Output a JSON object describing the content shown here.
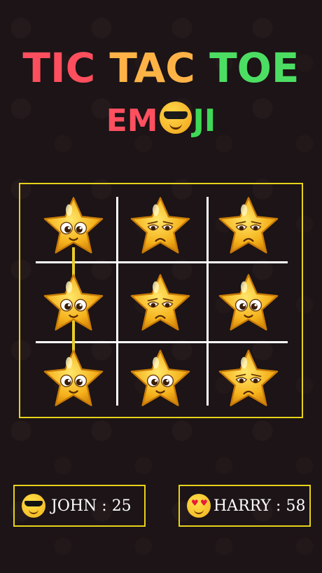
{
  "title": {
    "word1": "TIC",
    "word2": "TAC",
    "word3": "TOE",
    "sub_part1": "EM",
    "sub_part2": "JI",
    "sub_icon": "cool-sunglasses-emoji"
  },
  "colors": {
    "red": "#ff4f5e",
    "orange": "#ffb347",
    "green": "#4cde63",
    "border": "#e6d21c",
    "win_line": "#e8cc2a",
    "background": "#1c1416"
  },
  "board": {
    "cells": [
      {
        "row": 0,
        "col": 0,
        "piece": "star",
        "expression": "happy"
      },
      {
        "row": 0,
        "col": 1,
        "piece": "star",
        "expression": "sad"
      },
      {
        "row": 0,
        "col": 2,
        "piece": "star",
        "expression": "sad"
      },
      {
        "row": 1,
        "col": 0,
        "piece": "star",
        "expression": "happy"
      },
      {
        "row": 1,
        "col": 1,
        "piece": "star",
        "expression": "sad"
      },
      {
        "row": 1,
        "col": 2,
        "piece": "star",
        "expression": "happy"
      },
      {
        "row": 2,
        "col": 0,
        "piece": "star",
        "expression": "happy"
      },
      {
        "row": 2,
        "col": 1,
        "piece": "star",
        "expression": "happy"
      },
      {
        "row": 2,
        "col": 2,
        "piece": "star",
        "expression": "sad"
      }
    ],
    "winning_column": 0
  },
  "players": [
    {
      "icon": "sunglasses-emoji-icon",
      "label": "JOHN : 25"
    },
    {
      "icon": "heart-eyes-emoji-icon",
      "label": "HARRY : 58"
    }
  ]
}
